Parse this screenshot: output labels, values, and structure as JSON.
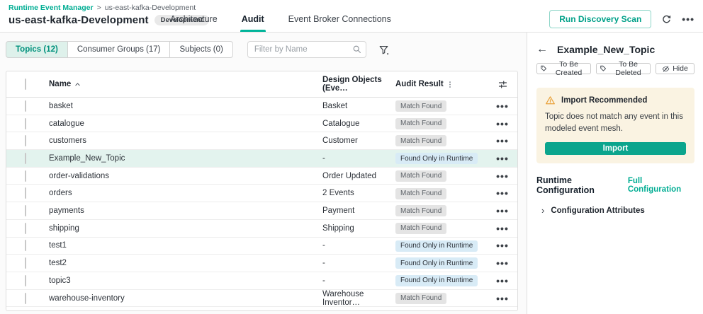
{
  "breadcrumb": {
    "link": "Runtime Event Manager",
    "separator": ">",
    "current": "us-east-kafka-Development"
  },
  "header": {
    "title": "us-east-kafka-Development",
    "env_badge": "Development",
    "tabs": [
      {
        "label": "Architecture",
        "active": false
      },
      {
        "label": "Audit",
        "active": true
      },
      {
        "label": "Event Broker Connections",
        "active": false
      }
    ],
    "run_discovery_label": "Run Discovery Scan",
    "icons": [
      "refresh-icon",
      "more-options-icon"
    ]
  },
  "filters": {
    "segments": [
      {
        "label": "Topics (12)",
        "active": true
      },
      {
        "label": "Consumer Groups (17)",
        "active": false
      },
      {
        "label": "Subjects (0)",
        "active": false
      }
    ],
    "search_placeholder": "Filter by Name",
    "icons": [
      "search-icon",
      "filter-funnel-icon",
      "column-settings-icon"
    ]
  },
  "table": {
    "columns": [
      "Name",
      "Design Objects (Eve…",
      "Audit Result"
    ],
    "rows": [
      {
        "name": "basket",
        "design": "Basket",
        "result": "Match Found",
        "type": "match",
        "selected": false
      },
      {
        "name": "catalogue",
        "design": "Catalogue",
        "result": "Match Found",
        "type": "match",
        "selected": false
      },
      {
        "name": "customers",
        "design": "Customer",
        "result": "Match Found",
        "type": "match",
        "selected": false
      },
      {
        "name": "Example_New_Topic",
        "design": "-",
        "result": "Found Only in Runtime",
        "type": "runtime",
        "selected": true
      },
      {
        "name": "order-validations",
        "design": "Order Updated",
        "result": "Match Found",
        "type": "match",
        "selected": false
      },
      {
        "name": "orders",
        "design": "2 Events",
        "result": "Match Found",
        "type": "match",
        "selected": false
      },
      {
        "name": "payments",
        "design": "Payment",
        "result": "Match Found",
        "type": "match",
        "selected": false
      },
      {
        "name": "shipping",
        "design": "Shipping",
        "result": "Match Found",
        "type": "match",
        "selected": false
      },
      {
        "name": "test1",
        "design": "-",
        "result": "Found Only in Runtime",
        "type": "runtime",
        "selected": false
      },
      {
        "name": "test2",
        "design": "-",
        "result": "Found Only in Runtime",
        "type": "runtime",
        "selected": false
      },
      {
        "name": "topic3",
        "design": "-",
        "result": "Found Only in Runtime",
        "type": "runtime",
        "selected": false
      },
      {
        "name": "warehouse-inventory",
        "design": "Warehouse Inventor…",
        "result": "Match Found",
        "type": "match",
        "selected": false
      }
    ]
  },
  "panel": {
    "title": "Example_New_Topic",
    "actions": [
      {
        "label": "To Be Created",
        "icon": "tag-icon"
      },
      {
        "label": "To Be Deleted",
        "icon": "tag-icon"
      },
      {
        "label": "Hide",
        "icon": "hide-eye-icon"
      }
    ],
    "warning": {
      "title": "Import Recommended",
      "body": "Topic does not match any event in this modeled event mesh.",
      "button": "Import"
    },
    "section_title": "Runtime Configuration",
    "full_config_link": "Full Configuration",
    "collapsible_label": "Configuration Attributes"
  },
  "colors": {
    "accent_teal": "#00ad93",
    "tab_underline": "#00b49a",
    "import_button": "#0ba58d",
    "segment_active_bg": "#def1eb",
    "selected_row_bg": "#e3f3ee",
    "badge_match_bg": "#e4e4e4",
    "badge_runtime_bg": "#d8ebf6",
    "warning_bg": "#faf3e2",
    "warning_icon": "#e9a23b"
  }
}
